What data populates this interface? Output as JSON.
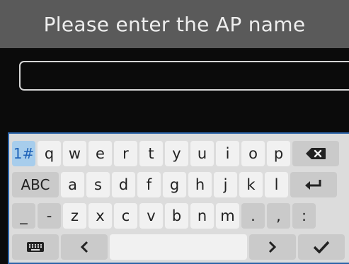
{
  "header": {
    "title": "Please enter the AP name"
  },
  "input": {
    "value": "",
    "placeholder": ""
  },
  "keyboard": {
    "row1": [
      "1#",
      "q",
      "w",
      "e",
      "r",
      "t",
      "y",
      "u",
      "i",
      "o",
      "p"
    ],
    "row2": [
      "ABC",
      "a",
      "s",
      "d",
      "f",
      "g",
      "h",
      "j",
      "k",
      "l"
    ],
    "row3": [
      "_",
      "-",
      "z",
      "x",
      "c",
      "v",
      "b",
      "n",
      "m",
      ".",
      ",",
      ":"
    ],
    "icons": {
      "backspace": "backspace-icon",
      "enter": "enter-icon",
      "keyboard": "keyboard-icon",
      "left": "chevron-left-icon",
      "right": "chevron-right-icon",
      "done": "checkmark-icon"
    },
    "colors": {
      "accent": "#2b63a8",
      "numeric_key_bg": "#a7cdec"
    }
  }
}
